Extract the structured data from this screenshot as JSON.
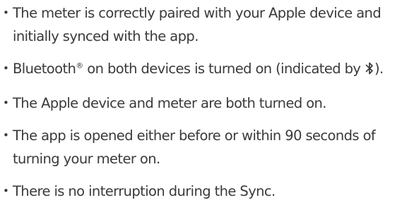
{
  "items": [
    {
      "text": "The meter is correctly paired with your Apple device and initially synced with the app."
    },
    {
      "prefix": "Bluetooth",
      "reg": "®",
      "middle": " on both devices is turned on (indicated by ",
      "icon": "bluetooth-icon",
      "suffix": ")."
    },
    {
      "text": "The Apple device and meter are both turned on."
    },
    {
      "text": "The app is opened either before or within 90 seconds of turning your meter on."
    },
    {
      "text": "There is no interruption during the Sync."
    }
  ],
  "bullet": "•"
}
